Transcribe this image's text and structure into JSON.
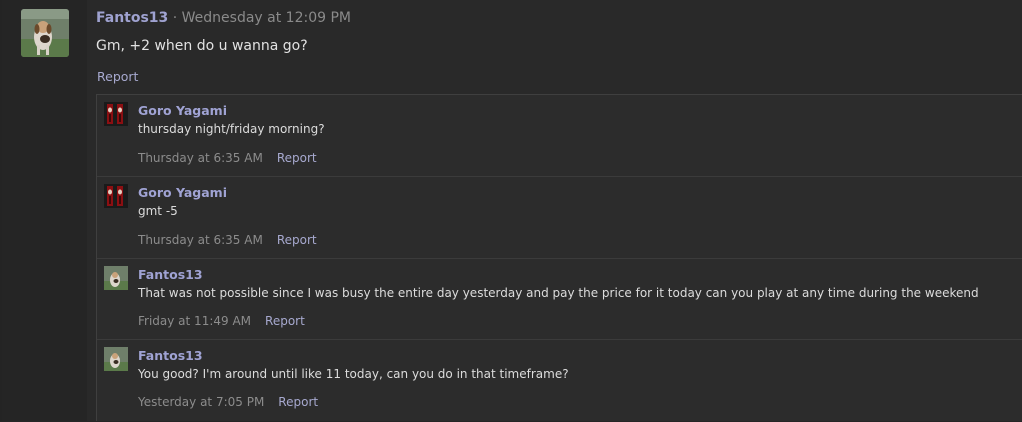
{
  "post": {
    "username": "Fantos13",
    "separator": "·",
    "timestamp": "Wednesday at 12:09 PM",
    "body": "Gm, +2 when do u wanna go?",
    "report_label": "Report"
  },
  "comments": [
    {
      "username": "Goro Yagami",
      "text": "thursday night/friday morning?",
      "time": "Thursday at 6:35 AM",
      "report_label": "Report"
    },
    {
      "username": "Goro Yagami",
      "text": "gmt -5",
      "time": "Thursday at 6:35 AM",
      "report_label": "Report"
    },
    {
      "username": "Fantos13",
      "text": "That was not possible since I was busy the entire day yesterday and pay the price for it today can you play at any time during the weekend",
      "time": "Friday at 11:49 AM",
      "report_label": "Report"
    },
    {
      "username": "Fantos13",
      "text": "You good? I'm around until like 11 today, can you do in that timeframe?",
      "time": "Yesterday at 7:05 PM",
      "report_label": "Report"
    }
  ],
  "colors": {
    "background": "#262626",
    "username": "#9fa2d0",
    "link": "#a7a9cf",
    "muted": "#8a8a8a"
  }
}
